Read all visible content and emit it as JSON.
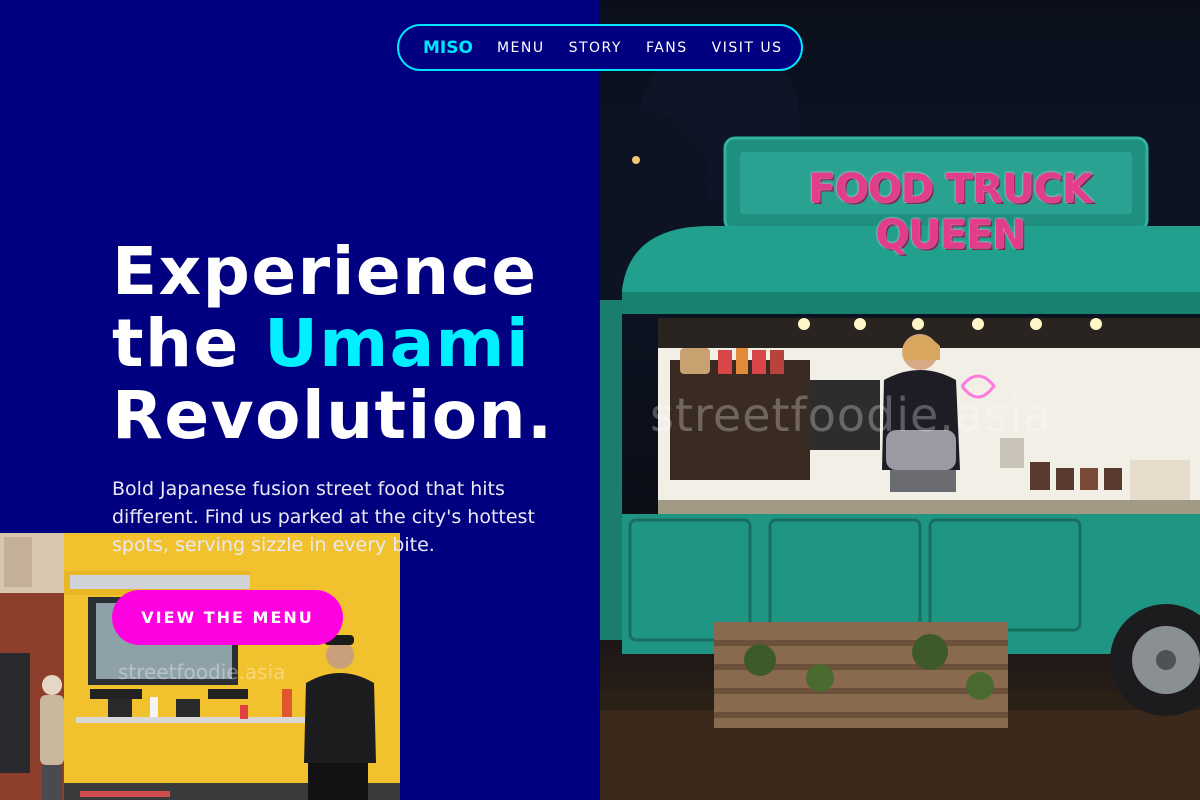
{
  "nav": {
    "brand": "MISO",
    "links": [
      "MENU",
      "STORY",
      "FANS",
      "VISIT US"
    ]
  },
  "hero": {
    "title_line1": "Experience",
    "title_line2_prefix": "the ",
    "title_line2_accent": "Umami",
    "title_line3": "Revolution.",
    "description": "Bold Japanese fusion street food that hits different. Find us parked at the city's hottest spots, serving sizzle in every bite.",
    "cta_label": "VIEW THE MENU"
  },
  "photos": {
    "right": {
      "sign_text": "FOOD TRUCK QUEEN",
      "watermark": "streetfoodie.asia"
    },
    "left": {
      "watermark": "streetfoodie.asia"
    }
  },
  "colors": {
    "background": "#000080",
    "accent_cyan": "#00e5ff",
    "cta_magenta": "#ff00e0",
    "text_white": "#ffffff"
  }
}
